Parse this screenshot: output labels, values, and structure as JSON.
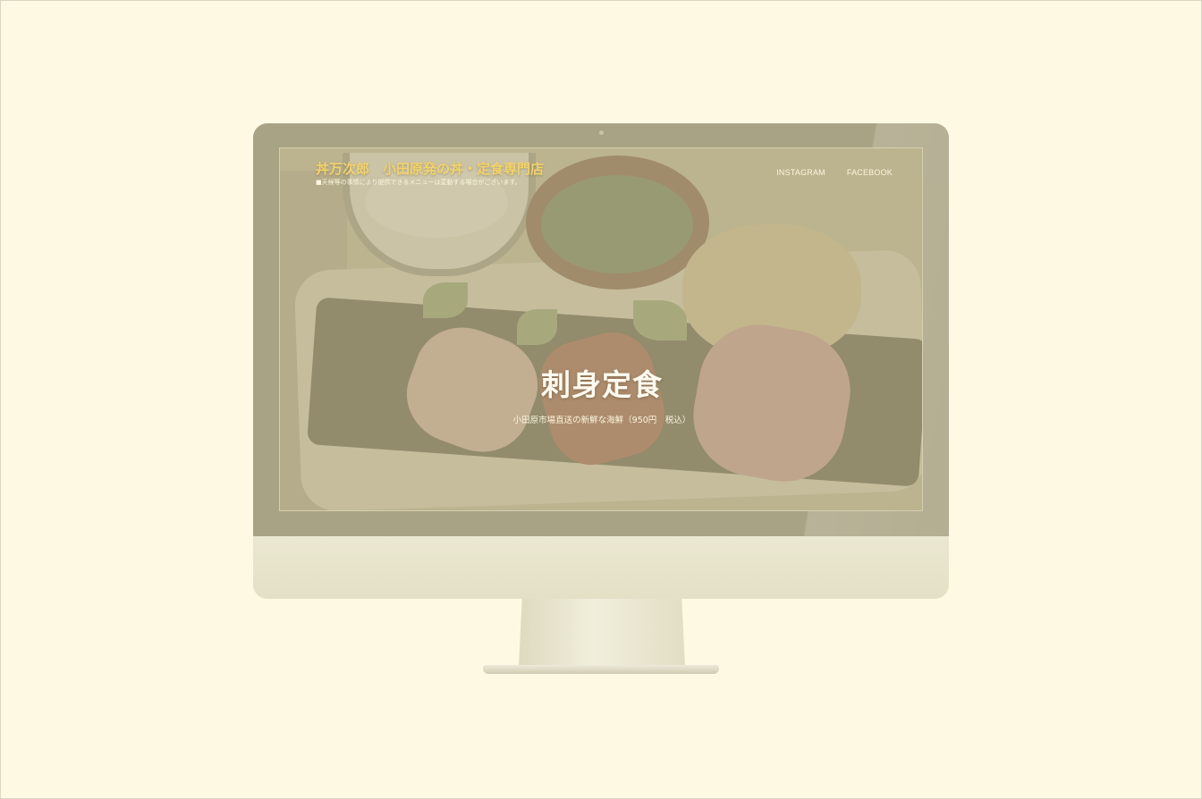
{
  "site": {
    "title": "丼万次郎　小田原発の丼・定食専門店",
    "notice": "■天候等の事情により提供できるメニューは変動する場合がございます。"
  },
  "nav": {
    "items": [
      {
        "label": "INSTAGRAM"
      },
      {
        "label": "FACEBOOK"
      }
    ]
  },
  "hero": {
    "title": "刺身定食",
    "subtitle": "小田原市場直送の新鮮な海鮮（950円　税込）"
  },
  "colors": {
    "background": "#fdf9e3",
    "bezel": "#a9a385",
    "title_accent": "#f3d36b",
    "hero_text": "#fffaf0"
  }
}
